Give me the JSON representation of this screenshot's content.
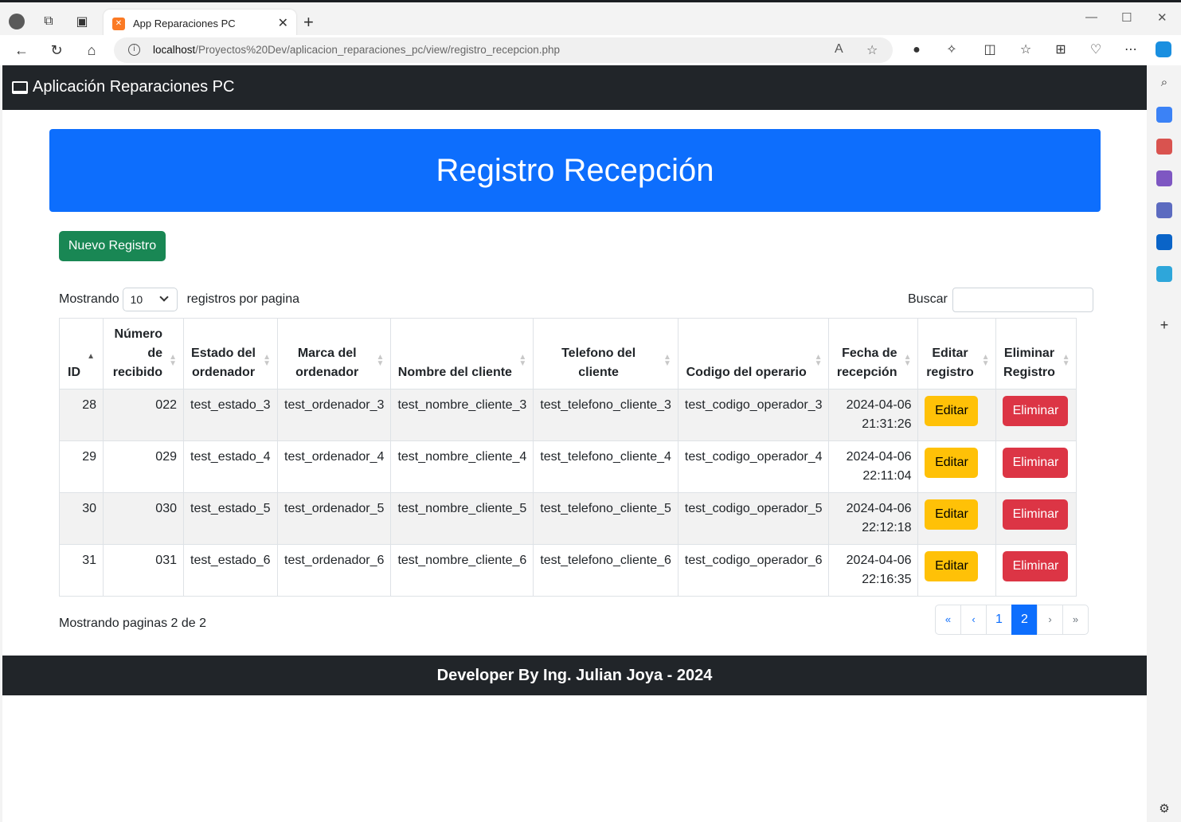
{
  "browser": {
    "tab_title": "App Reparaciones PC",
    "url_host": "localhost",
    "url_path": "/Proyectos%20Dev/aplicacion_reparaciones_pc/view/registro_recepcion.php"
  },
  "navbar": {
    "brand": "Aplicación Reparaciones PC"
  },
  "hero": {
    "title": "Registro Recepción"
  },
  "new_button": "Nuevo Registro",
  "length": {
    "prefix": "Mostrando",
    "value": "10",
    "suffix": "registros por pagina"
  },
  "search": {
    "label": "Buscar",
    "value": ""
  },
  "table": {
    "headers": [
      "ID",
      "Número de recibido",
      "Estado del ordenador",
      "Marca del ordenador",
      "Nombre del cliente",
      "Telefono del cliente",
      "Codigo del operario",
      "Fecha de recepción",
      "Editar registro",
      "Eliminar Registro"
    ],
    "sorted_column": "ID",
    "rows": [
      {
        "id": "28",
        "recibido": "022",
        "estado": "test_estado_3",
        "marca": "test_ordenador_3",
        "nombre": "test_nombre_cliente_3",
        "telefono": "test_telefono_cliente_3",
        "codigo": "test_codigo_operador_3",
        "fecha": "2024-04-06",
        "hora": "21:31:26",
        "edit": "Editar",
        "delete": "Eliminar"
      },
      {
        "id": "29",
        "recibido": "029",
        "estado": "test_estado_4",
        "marca": "test_ordenador_4",
        "nombre": "test_nombre_cliente_4",
        "telefono": "test_telefono_cliente_4",
        "codigo": "test_codigo_operador_4",
        "fecha": "2024-04-06",
        "hora": "22:11:04",
        "edit": "Editar",
        "delete": "Eliminar"
      },
      {
        "id": "30",
        "recibido": "030",
        "estado": "test_estado_5",
        "marca": "test_ordenador_5",
        "nombre": "test_nombre_cliente_5",
        "telefono": "test_telefono_cliente_5",
        "codigo": "test_codigo_operador_5",
        "fecha": "2024-04-06",
        "hora": "22:12:18",
        "edit": "Editar",
        "delete": "Eliminar"
      },
      {
        "id": "31",
        "recibido": "031",
        "estado": "test_estado_6",
        "marca": "test_ordenador_6",
        "nombre": "test_nombre_cliente_6",
        "telefono": "test_telefono_cliente_6",
        "codigo": "test_codigo_operador_6",
        "fecha": "2024-04-06",
        "hora": "22:16:35",
        "edit": "Editar",
        "delete": "Eliminar"
      }
    ]
  },
  "info": "Mostrando paginas 2 de 2",
  "pagination": {
    "first": "«",
    "prev": "‹",
    "pages": [
      "1",
      "2"
    ],
    "active": "2",
    "next": "›",
    "last": "»"
  },
  "footer": "Developer By Ing. Julian Joya - 2024",
  "colors": {
    "primary": "#0d6efd",
    "success": "#198754",
    "warning": "#ffc107",
    "danger": "#dc3545",
    "dark": "#212529"
  }
}
